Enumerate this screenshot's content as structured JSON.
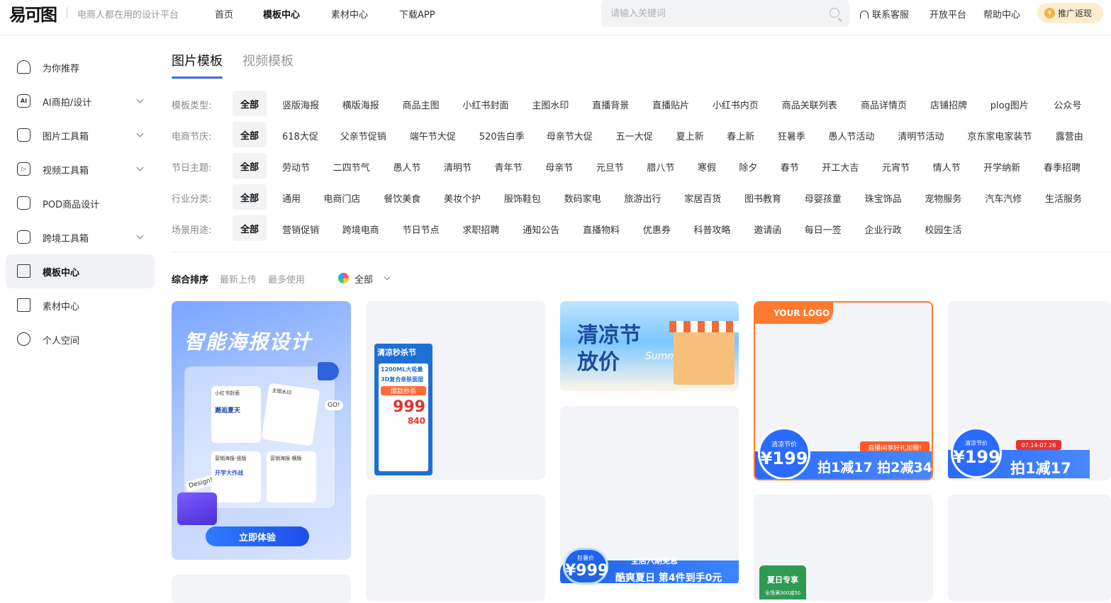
{
  "header": {
    "logo_text": "易可图",
    "slogan": "电商人都在用的设计平台",
    "nav": [
      "首页",
      "模板中心",
      "素材中心",
      "下载APP"
    ],
    "nav_active": "模板中心",
    "search_placeholder": "请输入关键词",
    "links": [
      "联系客服",
      "开放平台",
      "帮助中心"
    ],
    "promo_label": "推广返现",
    "promo_coin": "¥"
  },
  "sidebar": {
    "items": [
      {
        "label": "为你推荐",
        "icon": "home-icon"
      },
      {
        "label": "AI商拍/设计",
        "icon": "ai-icon",
        "icon_text": "AI"
      },
      {
        "label": "图片工具箱",
        "icon": "toolbox-icon"
      },
      {
        "label": "视频工具箱",
        "icon": "video-icon"
      },
      {
        "label": "POD商品设计",
        "icon": "lock-icon"
      },
      {
        "label": "跨境工具箱",
        "icon": "cross-border-icon"
      },
      {
        "label": "模板中心",
        "icon": "template-icon"
      },
      {
        "label": "素材中心",
        "icon": "material-icon"
      },
      {
        "label": "个人空间",
        "icon": "user-icon"
      }
    ]
  },
  "tabs": [
    "图片模板",
    "视频模板"
  ],
  "filters": {
    "all_label": "全部",
    "rows": [
      {
        "label": "模板类型:",
        "items": [
          "竖版海报",
          "横版海报",
          "商品主图",
          "小红书封面",
          "主图水印",
          "直播背景",
          "直播贴片",
          "小红书内页",
          "商品关联列表",
          "商品详情页",
          "店铺招牌",
          "plog图片",
          "公众号"
        ]
      },
      {
        "label": "电商节庆:",
        "items": [
          "618大促",
          "父亲节促销",
          "端午节大促",
          "520告白季",
          "母亲节大促",
          "五一大促",
          "夏上新",
          "春上新",
          "狂暑季",
          "愚人节活动",
          "清明节活动",
          "京东家电家装节",
          "露营由"
        ]
      },
      {
        "label": "节日主题:",
        "items": [
          "劳动节",
          "二四节气",
          "愚人节",
          "清明节",
          "青年节",
          "母亲节",
          "元旦节",
          "腊八节",
          "寒假",
          "除夕",
          "春节",
          "开工大吉",
          "元宵节",
          "情人节",
          "开学纳新",
          "春季招聘"
        ]
      },
      {
        "label": "行业分类:",
        "items": [
          "通用",
          "电商门店",
          "餐饮美食",
          "美妆个护",
          "服饰鞋包",
          "数码家电",
          "旅游出行",
          "家居百货",
          "图书教育",
          "母婴孩童",
          "珠宝饰品",
          "宠物服务",
          "汽车汽修",
          "生活服务"
        ]
      },
      {
        "label": "场景用途:",
        "items": [
          "营销促销",
          "跨境电商",
          "节日节点",
          "求职招聘",
          "通知公告",
          "直播物料",
          "优惠券",
          "科普攻略",
          "邀请函",
          "每日一签",
          "企业行政",
          "校园生活"
        ]
      }
    ]
  },
  "sort": {
    "options": [
      "综合排序",
      "最新上传",
      "最多使用"
    ],
    "color_filter": "全部"
  },
  "cards": {
    "ai_poster": {
      "title": "智能海报设计",
      "mini_labels": [
        "小红书封面",
        "主图水印",
        "营销海报-竖版",
        "营销海报-横版"
      ],
      "mini_texts": [
        "邂逅夏天",
        "开学大作战"
      ],
      "design_tag": "Design!",
      "go_tag": "GO!",
      "button": "立即体验"
    },
    "flash_sale": {
      "heading": "清凉秒杀节",
      "line1": "1200ML大吸量",
      "line2": "3D复合亲肤面层",
      "hot": "爆款秒杀",
      "price": "999",
      "price2": "840"
    },
    "summer": {
      "title_line1": "清凉节",
      "title_line2": "放价",
      "script": "Summer"
    },
    "logo_card": {
      "logo_text": "YOUR LOGO",
      "price_label": "清凉节价",
      "price": "¥199",
      "live_tag": "直播间享好礼加赠!",
      "deal": "拍1减17 拍2减34"
    },
    "partial_card": {
      "price_label": "清凉节价",
      "price": "¥199",
      "date": "07.14-07.26",
      "deal": "拍1减17"
    },
    "blue_banner": {
      "badge_label": "狂暑价",
      "price": "¥999",
      "line1": "全店六期免息",
      "line2": "酷爽夏日 第4件到手0元"
    },
    "green_tag": {
      "title": "夏日专享",
      "sub": "全场满300减50"
    }
  }
}
